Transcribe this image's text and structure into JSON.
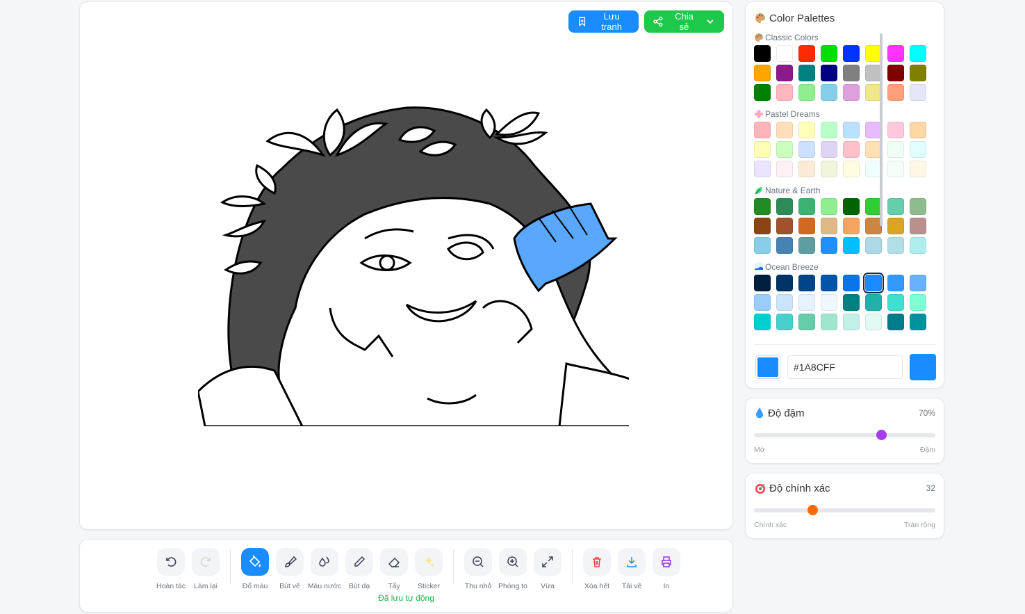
{
  "header": {
    "save_label": "Lưu tranh",
    "share_label": "Chia sẻ"
  },
  "toolbar": {
    "tools": [
      {
        "id": "undo",
        "label": "Hoàn tác"
      },
      {
        "id": "redo",
        "label": "Làm lại"
      },
      {
        "id": "fill",
        "label": "Đổ màu"
      },
      {
        "id": "brush",
        "label": "Bút vẽ"
      },
      {
        "id": "watercolor",
        "label": "Màu nước"
      },
      {
        "id": "pencil",
        "label": "Bút dạ"
      },
      {
        "id": "eraser",
        "label": "Tẩy"
      },
      {
        "id": "sticker",
        "label": "Sticker"
      },
      {
        "id": "zoom-out",
        "label": "Thu nhỏ"
      },
      {
        "id": "zoom-in",
        "label": "Phóng to"
      },
      {
        "id": "fit",
        "label": "Vừa"
      },
      {
        "id": "clear",
        "label": "Xóa hết"
      },
      {
        "id": "download",
        "label": "Tải về"
      },
      {
        "id": "print",
        "label": "In"
      }
    ],
    "active_tool": "fill",
    "autosave_status": "Đã lưu tự động"
  },
  "palette_panel": {
    "title": "Color Palettes",
    "groups": [
      {
        "name": "Classic Colors",
        "colors": [
          "#000000",
          "#ffffff",
          "#ff2a00",
          "#00e000",
          "#0033ff",
          "#ffff00",
          "#ff33ff",
          "#00ffff",
          "#ffa500",
          "#8b1a8b",
          "#008080",
          "#000080",
          "#808080",
          "#c0c0c0",
          "#800000",
          "#808000",
          "#008000",
          "#ffb6c1",
          "#90ee90",
          "#87ceeb",
          "#dda0dd",
          "#f0e68c",
          "#ffa07a",
          "#e6e6fa"
        ]
      },
      {
        "name": "Pastel Dreams",
        "colors": [
          "#ffb3ba",
          "#ffdfba",
          "#ffffba",
          "#baffc9",
          "#bae1ff",
          "#e8baff",
          "#ffc8dd",
          "#ffd6a5",
          "#fdffb6",
          "#caffbf",
          "#cce0ff",
          "#e0d4f5",
          "#ffc0cb",
          "#ffe0b2",
          "#f0fff4",
          "#e0fdff",
          "#ebe3ff",
          "#fff0f5",
          "#faebd7",
          "#f0f5dc",
          "#fffce0",
          "#f0ffff",
          "#f5fffa",
          "#fff8e7"
        ]
      },
      {
        "name": "Nature & Earth",
        "colors": [
          "#228b22",
          "#2e8b57",
          "#3cb371",
          "#90ee90",
          "#006400",
          "#32cd32",
          "#66cdaa",
          "#8fbc8f",
          "#8b4513",
          "#a0522d",
          "#d2691e",
          "#deb887",
          "#f4a460",
          "#cd853f",
          "#daa520",
          "#bc8f8f",
          "#87ceeb",
          "#4682b4",
          "#5f9ea0",
          "#1e90ff",
          "#00bfff",
          "#add8e6",
          "#b0e0e6",
          "#afeeee"
        ]
      },
      {
        "name": "Ocean Breeze",
        "colors": [
          "#001f3f",
          "#003366",
          "#00458a",
          "#0055aa",
          "#0a74ea",
          "#1a8cff",
          "#3399ff",
          "#66b2ff",
          "#99ccff",
          "#cce5ff",
          "#e6f2ff",
          "#f0f8ff",
          "#008080",
          "#20b2aa",
          "#40e0d0",
          "#7fffd4",
          "#00ced1",
          "#48d1cc",
          "#66cdaa",
          "#a0e6cf",
          "#c0f0e8",
          "#e0faf5",
          "#007c8a",
          "#00939e"
        ]
      }
    ],
    "selected_color": "#1A8CFF",
    "hex_value": "#1A8CFF"
  },
  "opacity": {
    "title": "Độ đậm",
    "value_label": "70%",
    "value": 70,
    "min_label": "Mờ",
    "max_label": "Đậm",
    "thumb_color": "#a73bf5"
  },
  "precision": {
    "title": "Độ chính xác",
    "value_label": "32",
    "value": 32,
    "max": 100,
    "min_label": "Chính xác",
    "max_label": "Tràn rộng",
    "thumb_color": "#ff6a00"
  },
  "colors": {
    "accent_blue": "#1a8cff",
    "accent_green": "#1ec84a",
    "danger": "#ef4444"
  }
}
